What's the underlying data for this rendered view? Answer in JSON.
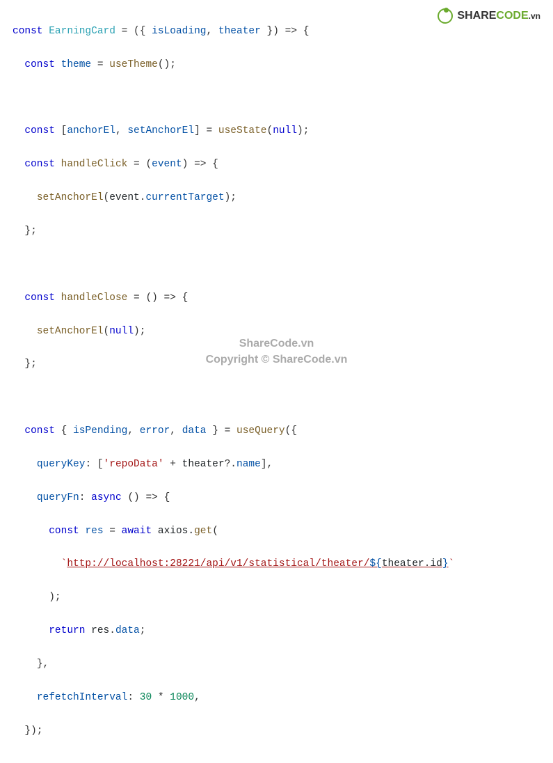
{
  "watermark": {
    "logo_share": "SHARE",
    "logo_code": "CODE",
    "logo_vn": ".vn",
    "center_line1": "ShareCode.vn",
    "center_line2": "Copyright © ShareCode.vn"
  },
  "code": {
    "l1_const": "const",
    "l1_name": "EarningCard",
    "l1_eq": " = ({ ",
    "l1_p1": "isLoading",
    "l1_c": ", ",
    "l1_p2": "theater",
    "l1_end": " }) => {",
    "l2_const": "const",
    "l2_var": "theme",
    "l2_eq": " = ",
    "l2_fn": "useTheme",
    "l2_end": "();",
    "l4_const": "const",
    "l4_br": " [",
    "l4_v1": "anchorEl",
    "l4_c": ", ",
    "l4_v2": "setAnchorEl",
    "l4_br2": "] = ",
    "l4_fn": "useState",
    "l4_arg": "(",
    "l4_null": "null",
    "l4_end": ");",
    "l5_const": "const",
    "l5_name": "handleClick",
    "l5_eq": " = (",
    "l5_param": "event",
    "l5_end": ") => {",
    "l6_fn": "setAnchorEl",
    "l6_op": "(",
    "l6_ev": "event",
    "l6_dot": ".",
    "l6_ct": "currentTarget",
    "l6_end": ");",
    "l7": "};",
    "l9_const": "const",
    "l9_name": "handleClose",
    "l9_eq": " = () => {",
    "l10_fn": "setAnchorEl",
    "l10_op": "(",
    "l10_null": "null",
    "l10_end": ");",
    "l11": "};",
    "l13_const": "const",
    "l13_br": " { ",
    "l13_v1": "isPending",
    "l13_c1": ", ",
    "l13_v2": "error",
    "l13_c2": ", ",
    "l13_v3": "data",
    "l13_br2": " } = ",
    "l13_fn": "useQuery",
    "l13_end": "({",
    "l14_k": "queryKey",
    "l14_c": ": [",
    "l14_str": "'repoData'",
    "l14_plus": " + ",
    "l14_th": "theater",
    "l14_opt": "?.",
    "l14_name": "name",
    "l14_end": "],",
    "l15_k": "queryFn",
    "l15_c": ": ",
    "l15_async": "async",
    "l15_end": " () => {",
    "l16_const": "const",
    "l16_var": "res",
    "l16_eq": " = ",
    "l16_await": "await",
    "l16_ax": " axios.",
    "l16_get": "get",
    "l16_end": "(",
    "l17_tick": "`",
    "l17_url": "http://localhost:28221/api/v1/statistical/theater/",
    "l17_tpl_open": "${",
    "l17_th": "theater",
    "l17_dot": ".",
    "l17_id": "id",
    "l17_tpl_close": "}",
    "l17_tick2": "`",
    "l18": ");",
    "l19_ret": "return",
    "l19_sp": " ",
    "l19_res": "res",
    "l19_dot": ".",
    "l19_data": "data",
    "l19_end": ";",
    "l20": "},",
    "l21_k": "refetchInterval",
    "l21_c": ": ",
    "l21_n1": "30",
    "l21_op": " * ",
    "l21_n2": "1000",
    "l21_end": ",",
    "l22": "});"
  }
}
